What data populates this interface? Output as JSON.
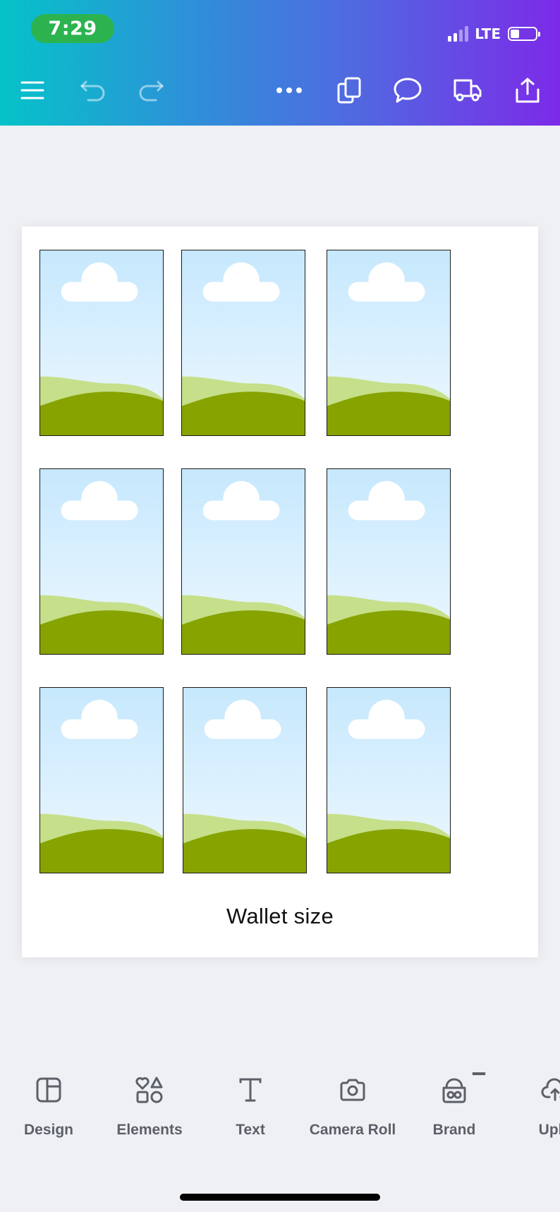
{
  "status_bar": {
    "time": "7:29",
    "network": "LTE",
    "battery_level": 0.35,
    "signal_bars_active": 2,
    "signal_bars_total": 4
  },
  "toolbar": {
    "icons": [
      "menu-icon",
      "undo-icon",
      "redo-icon",
      "more-icon",
      "pages-icon",
      "comment-icon",
      "print-delivery-icon",
      "share-icon"
    ]
  },
  "canvas": {
    "caption": "Wallet size",
    "photo_count": 9,
    "photo_placeholder": "sky-cloud-hills"
  },
  "bottom_tools": [
    {
      "label": "Design",
      "icon": "design-icon"
    },
    {
      "label": "Elements",
      "icon": "elements-icon"
    },
    {
      "label": "Text",
      "icon": "text-icon"
    },
    {
      "label": "Camera Roll",
      "icon": "camera-icon"
    },
    {
      "label": "Brand",
      "icon": "brand-icon",
      "badge": "crown-icon"
    },
    {
      "label": "Uplo",
      "icon": "upload-icon"
    }
  ],
  "colors": {
    "header_gradient": [
      "#05c3c8",
      "#2f8fd9",
      "#4f6be0",
      "#7c2ae8"
    ],
    "time_pill": "#2cb34f",
    "background": "#eff0f4",
    "sky_top": "#c6e8fd",
    "sky_bottom": "#eef8ff",
    "hill_light": "#c6df8a",
    "hill_dark": "#86a300",
    "label_gray": "#5b6068"
  }
}
